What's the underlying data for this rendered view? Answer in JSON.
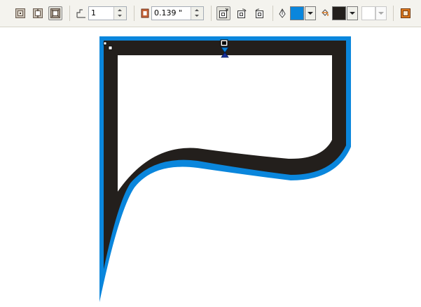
{
  "toolbar": {
    "contour_steps_value": "1",
    "contour_offset_value": "0.139 \"",
    "outline_color": "#0a86dc",
    "fill_color": "#231f1c",
    "accel_color": "#ffffff"
  },
  "icons": {
    "to_center": "contour-to-center-icon",
    "inside": "contour-inside-icon",
    "outside": "contour-outside-icon",
    "steps": "contour-steps-icon",
    "offset": "contour-offset-icon",
    "linear_color": "linear-contour-colors-icon",
    "clockwise_color": "clockwise-contour-colors-icon",
    "counterclockwise_color": "counterclockwise-contour-colors-icon",
    "outline_pen": "outline-pen-icon",
    "fill_bucket": "fill-bucket-icon",
    "object_acceleration": "object-acceleration-icon"
  },
  "canvas": {
    "shape_outline_color": "#0a86dc",
    "shape_contour_color": "#231f1c",
    "shape_inner_color": "#ffffff"
  }
}
